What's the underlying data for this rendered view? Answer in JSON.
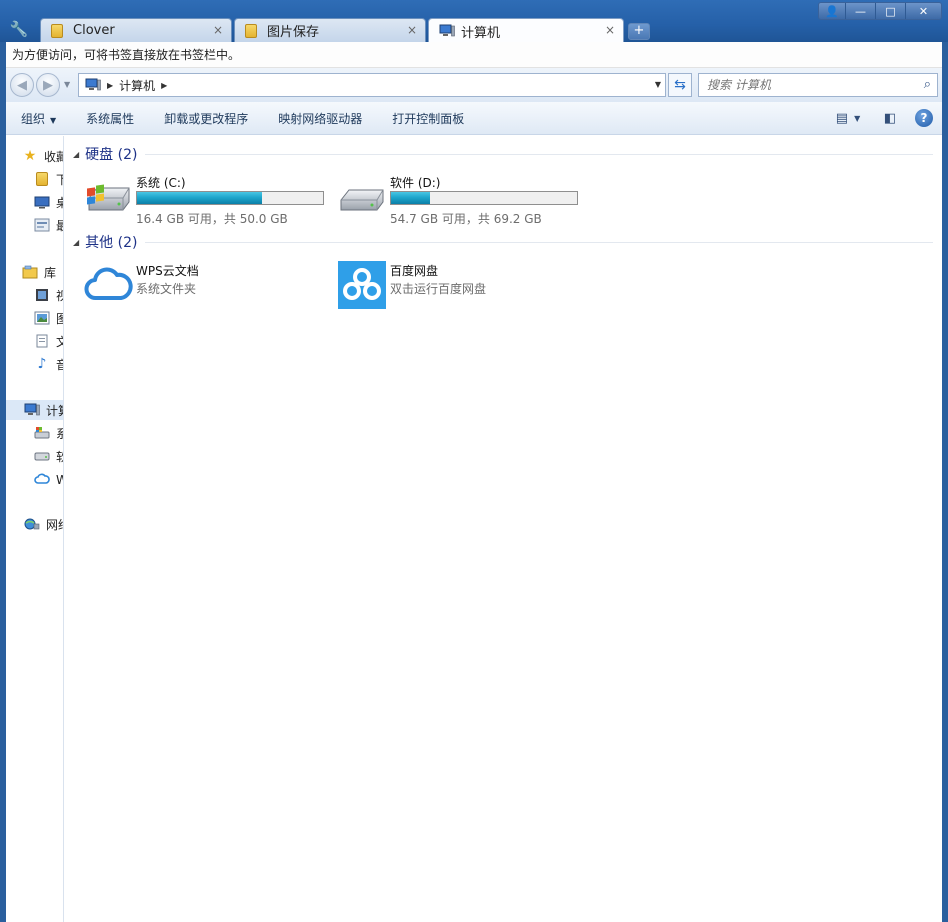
{
  "window": {
    "tabs": [
      {
        "label": "Clover",
        "close": "×"
      },
      {
        "label": "图片保存",
        "close": "×"
      },
      {
        "label": "计算机",
        "close": "×"
      }
    ],
    "new_tab": "+",
    "buttons": {
      "user": "👤",
      "minimize": "—",
      "maximize": "□",
      "close": "✕"
    }
  },
  "bookmark_bar": {
    "text": "为方便访问，可将书签直接放在书签栏中。"
  },
  "address": {
    "crumbs": [
      "计算机"
    ],
    "search_placeholder": "搜索 计算机"
  },
  "toolbar": {
    "items": [
      "组织",
      "系统属性",
      "卸载或更改程序",
      "映射网络驱动器",
      "打开控制面板"
    ]
  },
  "nav_pane": {
    "items": [
      {
        "label": "收藏夹"
      },
      {
        "label": "下载"
      },
      {
        "label": "桌面"
      },
      {
        "label": "最近访问的位置"
      },
      {
        "label": "库"
      },
      {
        "label": "视频"
      },
      {
        "label": "图片"
      },
      {
        "label": "文档"
      },
      {
        "label": "音乐"
      },
      {
        "label": "计算机"
      },
      {
        "label": "系统 (C:)"
      },
      {
        "label": "软件 (D:)"
      },
      {
        "label": "WPS云文档"
      },
      {
        "label": "网络"
      }
    ]
  },
  "groups": {
    "hard_disks": {
      "title": "硬盘 (2)",
      "drives": [
        {
          "name": "系统 (C:)",
          "free_text": "16.4 GB 可用，共 50.0 GB",
          "used_fraction": 0.672
        },
        {
          "name": "软件 (D:)",
          "free_text": "54.7 GB 可用，共 69.2 GB",
          "used_fraction": 0.21
        }
      ]
    },
    "other": {
      "title": "其他 (2)",
      "items": [
        {
          "name": "WPS云文档",
          "sub": "系统文件夹"
        },
        {
          "name": "百度网盘",
          "sub": "双击运行百度网盘"
        }
      ]
    }
  },
  "colors": {
    "title_bar": "#2560a8",
    "group_title": "#1e3287",
    "drive_bar": "#1ea6cc",
    "baidu_blue": "#2f9fe8"
  }
}
